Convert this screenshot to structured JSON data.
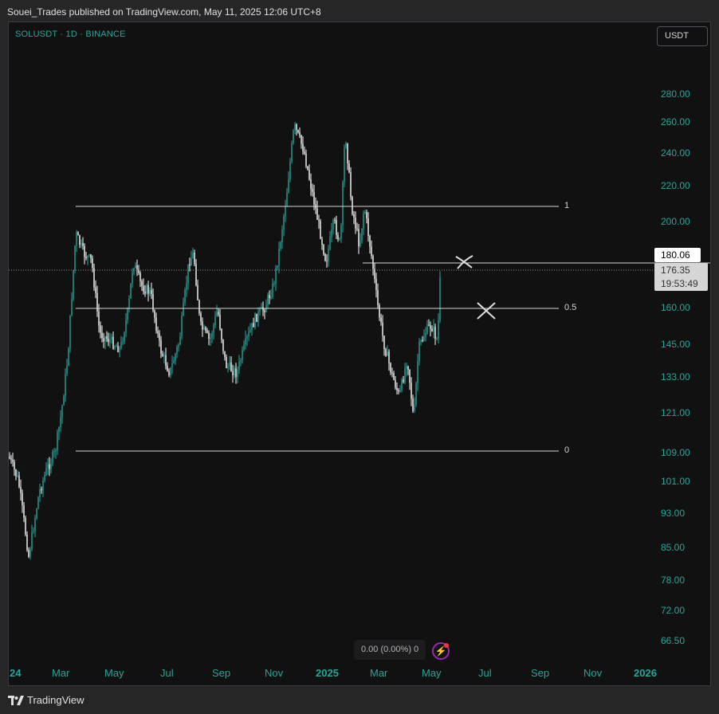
{
  "header": {
    "published_text": "Souei_Trades published on TradingView.com, May 11, 2025 12:06 UTC+8"
  },
  "chart": {
    "symbol_title": "SOLUSDT · 1D · BINANCE",
    "currency_button": "USDT",
    "last_price": "180.06",
    "current_price": "176.35",
    "countdown": "19:53:49",
    "volume_readout": "0.00 (0.00%) 0",
    "flash_icon_glyph": "⚡"
  },
  "y_axis": {
    "labels": [
      "280.00",
      "260.00",
      "240.00",
      "220.00",
      "200.00",
      "160.00",
      "145.00",
      "133.00",
      "121.00",
      "109.00",
      "101.00",
      "93.00",
      "85.00",
      "78.00",
      "72.00",
      "66.50"
    ]
  },
  "x_axis": {
    "labels": [
      "24",
      "Mar",
      "May",
      "Jul",
      "Sep",
      "Nov",
      "2025",
      "Mar",
      "May",
      "Jul",
      "Sep",
      "Nov",
      "2026"
    ]
  },
  "fib_levels": {
    "level_1": "1",
    "level_05": "0.5",
    "level_0": "0"
  },
  "footer": {
    "brand": "TradingView"
  },
  "colors": {
    "accent": "#26a69a",
    "candle_up": "#26a69a",
    "candle_down": "#ffffff",
    "background": "#111111",
    "frame": "#262626"
  }
}
